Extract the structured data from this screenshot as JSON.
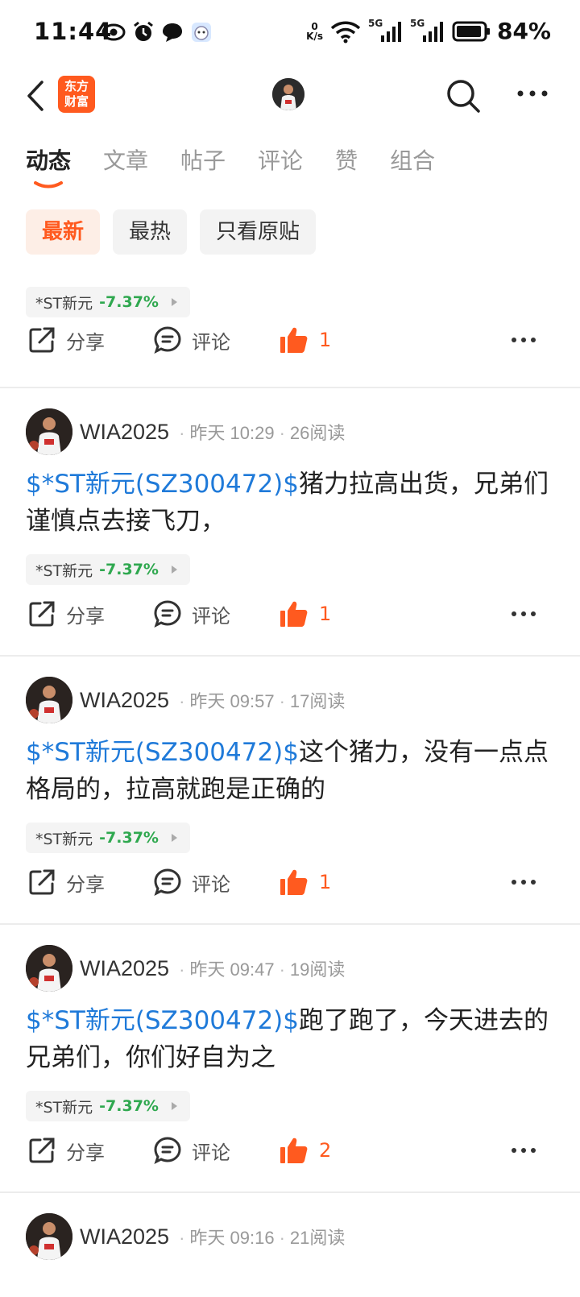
{
  "status_bar": {
    "time": "11:44",
    "net_speed_value": "0",
    "net_speed_unit": "K/s",
    "signal_1": "5G",
    "signal_2": "5G",
    "battery": "84%"
  },
  "header": {
    "logo_line1": "东方",
    "logo_line2": "财富",
    "brand_color": "#ff5a1f"
  },
  "tabs": [
    "动态",
    "文章",
    "帖子",
    "评论",
    "赞",
    "组合"
  ],
  "filters": [
    "最新",
    "最热",
    "只看原贴"
  ],
  "actions": {
    "share": "分享",
    "comment": "评论"
  },
  "partial_post": {
    "stock_name": "*ST新元",
    "stock_change": "-7.37%",
    "likes": "1"
  },
  "posts": [
    {
      "username": "WIA2025",
      "time": "昨天 10:29",
      "reads": "26阅读",
      "stock_link": "$*ST新元(SZ300472)$",
      "text": "猪力拉高出货，兄弟们谨慎点去接飞刀，",
      "stock_name": "*ST新元",
      "stock_change": "-7.37%",
      "likes": "1"
    },
    {
      "username": "WIA2025",
      "time": "昨天 09:57",
      "reads": "17阅读",
      "stock_link": "$*ST新元(SZ300472)$",
      "text": "这个猪力，没有一点点格局的，拉高就跑是正确的",
      "stock_name": "*ST新元",
      "stock_change": "-7.37%",
      "likes": "1"
    },
    {
      "username": "WIA2025",
      "time": "昨天 09:47",
      "reads": "19阅读",
      "stock_link": "$*ST新元(SZ300472)$",
      "text": "跑了跑了，今天进去的兄弟们，你们好自为之",
      "stock_name": "*ST新元",
      "stock_change": "-7.37%",
      "likes": "2"
    },
    {
      "username": "WIA2025",
      "time": "昨天 09:16",
      "reads": "21阅读"
    }
  ]
}
